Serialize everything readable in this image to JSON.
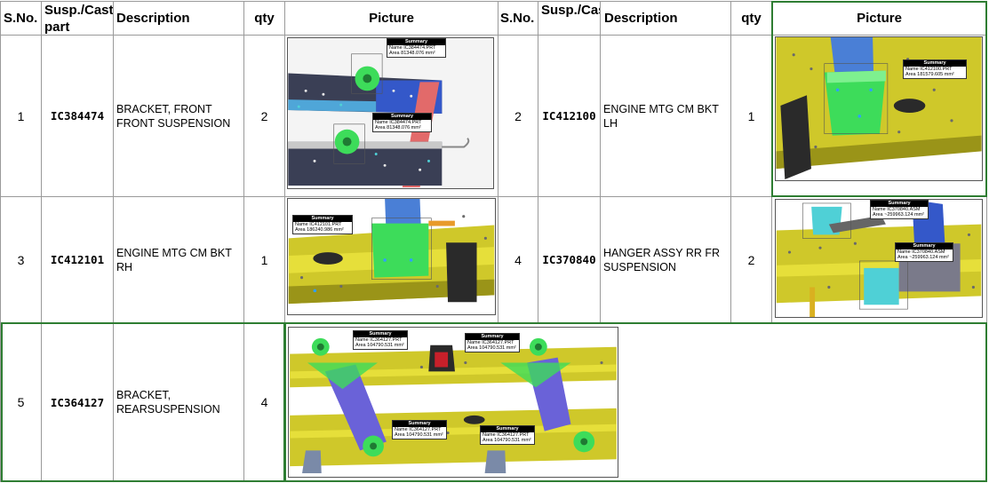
{
  "headers": {
    "sno": "S.No.",
    "part": "Susp./Casting part",
    "part_right": "Susp./Casting",
    "description": "Description",
    "qty": "qty",
    "picture": "Picture"
  },
  "rows": [
    {
      "sno": "1",
      "part": "IC384474",
      "description": "BRACKET, FRONT FRONT SUSPENSION",
      "qty": "2"
    },
    {
      "sno": "2",
      "part": "IC412100",
      "description": "ENGINE MTG CM BKT LH",
      "qty": "1"
    },
    {
      "sno": "3",
      "part": "IC412101",
      "description": "ENGINE MTG CM BKT RH",
      "qty": "1"
    },
    {
      "sno": "4",
      "part": "IC370840",
      "description": "HANGER ASSY RR FR SUSPENSION",
      "qty": "2"
    },
    {
      "sno": "5",
      "part": "IC364127",
      "description": "BRACKET, REARSUSPENSION",
      "qty": "4"
    }
  ],
  "summaries": {
    "p1a": {
      "title": "Summary",
      "name": "Name IC384474.PRT",
      "area": "Area 81348.076 mm²"
    },
    "p1b": {
      "title": "Summary",
      "name": "Name IC384474.PRT",
      "area": "Area 81348.076 mm²"
    },
    "p2": {
      "title": "Summary",
      "name": "Name IC412100.PRT",
      "area": "Area 181579.605 mm²"
    },
    "p3": {
      "title": "Summary",
      "name": "Name IC412101.PRT",
      "area": "Area 186240.986 mm²"
    },
    "p4a": {
      "title": "Summary",
      "name": "Name IC370840.ASM",
      "area": "Area ~259963.124 mm²"
    },
    "p4b": {
      "title": "Summary",
      "name": "Name IC370840.ASM",
      "area": "Area ~259963.124 mm²"
    },
    "p5a": {
      "title": "Summary",
      "name": "Name IC364127.PRT",
      "area": "Area 104790.531 mm²"
    },
    "p5b": {
      "title": "Summary",
      "name": "Name IC364127.PRT",
      "area": "Area 104790.531 mm²"
    },
    "p5c": {
      "title": "Summary",
      "name": "Name IC364127.PRT",
      "area": "Area 104790.531 mm²"
    },
    "p5d": {
      "title": "Summary",
      "name": "Name IC364127.PRT",
      "area": "Area 104790.531 mm²"
    }
  },
  "colors": {
    "frame_yellow": "#d9d12a",
    "frame_dark": "#3a3f55",
    "part_green": "#3ddc5a",
    "part_blue": "#4a7fd6",
    "part_cyan": "#4fd0d6",
    "table_border": "#9a9a9a",
    "highlight_border": "#2e7d32"
  }
}
